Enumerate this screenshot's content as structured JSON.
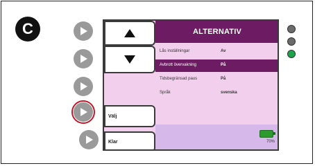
{
  "panel_badge": "C",
  "header": {
    "title": "ALTERNATIV"
  },
  "menu": {
    "items": [
      {
        "label": "Lås inställningar",
        "value": "Av"
      },
      {
        "label": "Avbrott övervakning",
        "value": "På"
      },
      {
        "label": "Tidsbegränsad paus",
        "value": "På"
      },
      {
        "label": "Språk",
        "value": "svenska"
      }
    ],
    "selected_index": 1
  },
  "softkeys": {
    "up_icon": "arrow-up-icon",
    "down_icon": "arrow-down-icon",
    "select_label": "Välj",
    "done_label": "Klar"
  },
  "battery": {
    "percent_label": "70%",
    "level": 0.7
  },
  "colors": {
    "title_bar": "#6d1c63",
    "screen_bg": "#f3cfee",
    "highlight_ring": "#c2182b",
    "led_green": "#1aa34a",
    "led_gray": "#6b6b6b"
  },
  "status_leds": [
    {
      "name": "led-top",
      "state": "off"
    },
    {
      "name": "led-middle",
      "state": "off"
    },
    {
      "name": "led-bottom",
      "state": "on"
    }
  ]
}
